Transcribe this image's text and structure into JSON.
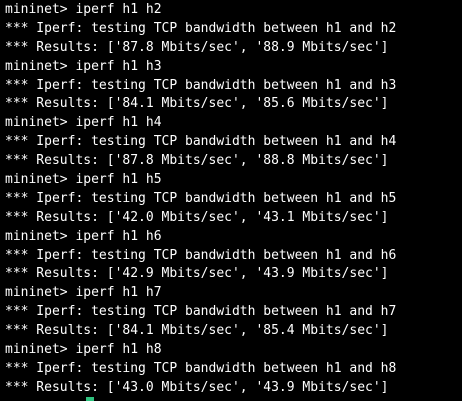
{
  "terminal": {
    "lines": [
      "mininet> iperf h1 h2",
      "*** Iperf: testing TCP bandwidth between h1 and h2",
      "*** Results: ['87.8 Mbits/sec', '88.9 Mbits/sec']",
      "mininet> iperf h1 h3",
      "*** Iperf: testing TCP bandwidth between h1 and h3",
      "*** Results: ['84.1 Mbits/sec', '85.6 Mbits/sec']",
      "mininet> iperf h1 h4",
      "*** Iperf: testing TCP bandwidth between h1 and h4",
      "*** Results: ['87.8 Mbits/sec', '88.8 Mbits/sec']",
      "mininet> iperf h1 h5",
      "*** Iperf: testing TCP bandwidth between h1 and h5",
      "*** Results: ['42.0 Mbits/sec', '43.1 Mbits/sec']",
      "mininet> iperf h1 h6",
      "*** Iperf: testing TCP bandwidth between h1 and h6",
      "*** Results: ['42.9 Mbits/sec', '43.9 Mbits/sec']",
      "mininet> iperf h1 h7",
      "*** Iperf: testing TCP bandwidth between h1 and h7",
      "*** Results: ['84.1 Mbits/sec', '85.4 Mbits/sec']",
      "mininet> iperf h1 h8",
      "*** Iperf: testing TCP bandwidth between h1 and h8",
      "*** Results: ['43.0 Mbits/sec', '43.9 Mbits/sec']"
    ],
    "colors": {
      "background": "#000000",
      "text": "#ffffff",
      "cursor": "#2ec27e"
    }
  }
}
